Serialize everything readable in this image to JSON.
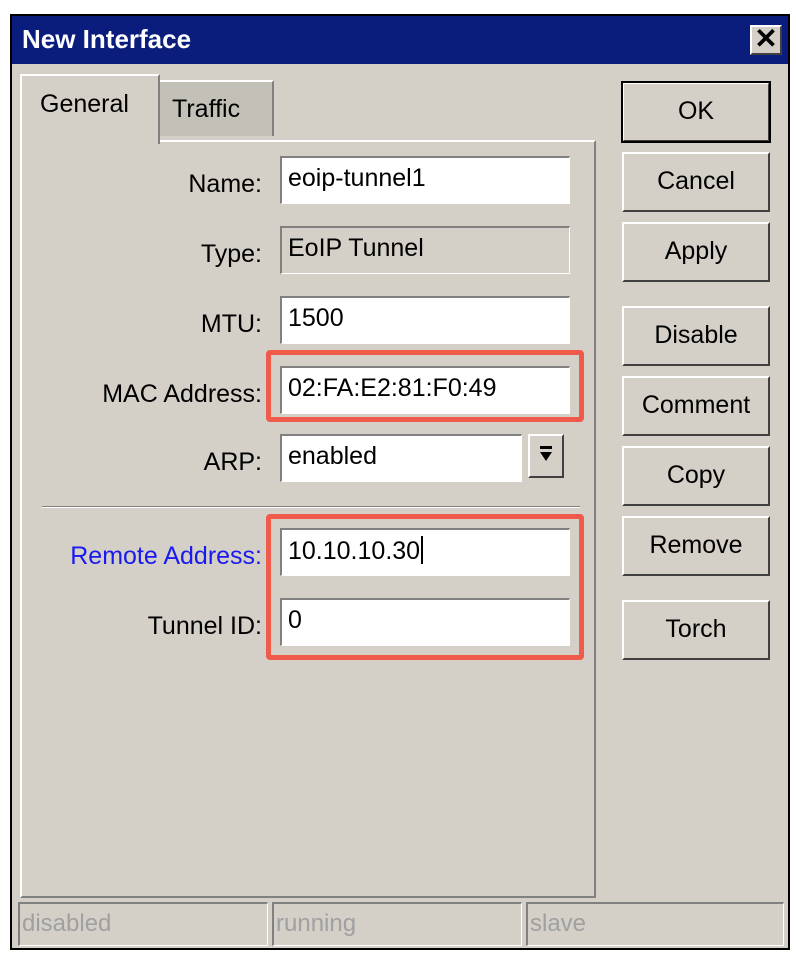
{
  "window": {
    "title": "New Interface",
    "close_glyph": "✕"
  },
  "tabs": [
    {
      "label": "General",
      "active": true
    },
    {
      "label": "Traffic",
      "active": false
    }
  ],
  "form": {
    "name": {
      "label": "Name:",
      "value": "eoip-tunnel1"
    },
    "type": {
      "label": "Type:",
      "value": "EoIP Tunnel"
    },
    "mtu": {
      "label": "MTU:",
      "value": "1500"
    },
    "mac": {
      "label": "MAC Address:",
      "value": "02:FA:E2:81:F0:49"
    },
    "arp": {
      "label": "ARP:",
      "value": "enabled"
    },
    "remote": {
      "label": "Remote Address:",
      "value": "10.10.10.30"
    },
    "tunnel_id": {
      "label": "Tunnel ID:",
      "value": "0"
    }
  },
  "buttons": {
    "ok": "OK",
    "cancel": "Cancel",
    "apply": "Apply",
    "disable": "Disable",
    "comment": "Comment",
    "copy": "Copy",
    "remove": "Remove",
    "torch": "Torch"
  },
  "status": {
    "disabled": "disabled",
    "running": "running",
    "slave": "slave"
  },
  "colors": {
    "title_bar": "#0a1d7c",
    "highlight": "#ef5a4a",
    "remote_label": "#1a1aee",
    "window_bg": "#d4d0c8"
  }
}
